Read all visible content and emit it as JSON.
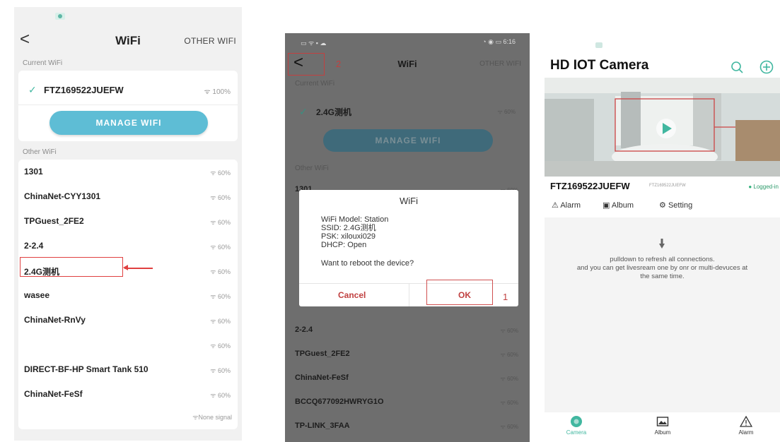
{
  "panel1": {
    "title": "WiFi",
    "other_wifi": "OTHER WIFI",
    "current_section": "Current WiFi",
    "current": {
      "name": "FTZ169522JUEFW",
      "signal": "100%"
    },
    "manage_label": "MANAGE WIFI",
    "other_section": "Other WiFi",
    "networks": [
      {
        "name": "1301",
        "signal": "60%"
      },
      {
        "name": "ChinaNet-CYY1301",
        "signal": "60%"
      },
      {
        "name": "TPGuest_2FE2",
        "signal": "60%"
      },
      {
        "name": "2-2.4",
        "signal": "60%"
      },
      {
        "name": "2.4G测机",
        "signal": "60%"
      },
      {
        "name": "wasee",
        "signal": "60%"
      },
      {
        "name": "ChinaNet-RnVy",
        "signal": "60%"
      },
      {
        "name": "",
        "signal": "60%"
      },
      {
        "name": "DIRECT-BF-HP Smart Tank 510",
        "signal": "60%"
      },
      {
        "name": "ChinaNet-FeSf",
        "signal": "60%"
      }
    ],
    "none_signal": "None signal"
  },
  "panel2": {
    "status_time": "6:16",
    "title": "WiFi",
    "other_wifi": "OTHER WIFI",
    "step2": "2",
    "current_section": "Current WiFi",
    "current": {
      "name": "2.4G测机",
      "signal": "60%"
    },
    "manage_label": "MANAGE WIFI",
    "other_section": "Other WiFi",
    "network_top": {
      "name": "1301",
      "signal": "60%"
    },
    "networks_below": [
      {
        "name": "2-2.4",
        "signal": "60%"
      },
      {
        "name": "TPGuest_2FE2",
        "signal": "60%"
      },
      {
        "name": "ChinaNet-FeSf",
        "signal": "60%"
      },
      {
        "name": "BCCQ677092HWRYG1O",
        "signal": "60%"
      },
      {
        "name": "TP-LINK_3FAA",
        "signal": "60%"
      }
    ],
    "dialog": {
      "title": "WiFi",
      "line1": "WiFi Model: Station",
      "line2": "SSID: 2.4G测机",
      "line3": "PSK: xilouxi029",
      "line4": "DHCP: Open",
      "question": "Want to reboot the device?",
      "cancel": "Cancel",
      "ok": "OK",
      "step1": "1"
    }
  },
  "panel3": {
    "app_title": "HD IOT Camera",
    "device_name": "FTZ169522JUEFW",
    "device_sub": "FTZ169522JUEFW",
    "status": "Logged-in",
    "actions": {
      "alarm": "Alarm",
      "album": "Album",
      "setting": "Setting"
    },
    "hint_line1": "pulldown to refresh all connections.",
    "hint_line2": "and you can get livesream one by onr or multi-devuces at",
    "hint_line3": "the same time.",
    "tabs": {
      "camera": "Camera",
      "album": "Album",
      "alarm": "Alarm"
    },
    "accent": "#41b7a0"
  }
}
